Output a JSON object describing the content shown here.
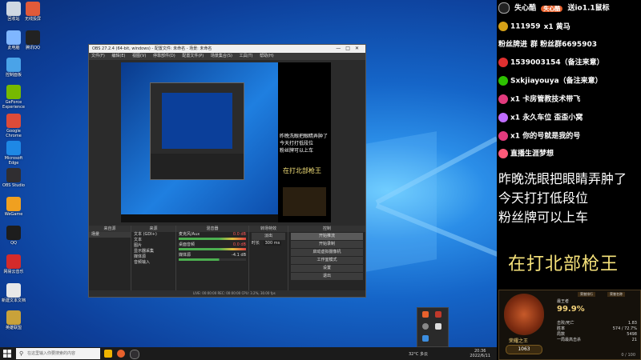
{
  "desktop": {
    "icons": [
      {
        "label": "回收站",
        "color": "#cfd8e3"
      },
      {
        "label": "无线投屏",
        "color": "#e05a3a"
      },
      {
        "label": "此电脑",
        "color": "#7fb6ff"
      },
      {
        "label": "腾讯QQ",
        "color": "#222222"
      },
      {
        "label": "控制面板",
        "color": "#4aa3e8"
      },
      {
        "label": "GeForce Experience",
        "color": "#76b900"
      },
      {
        "label": "Google Chrome",
        "color": "#dd4b39"
      },
      {
        "label": "Microsoft Edge",
        "color": "#1e88e5"
      },
      {
        "label": "OBS Studio",
        "color": "#302e31"
      },
      {
        "label": "WeGame",
        "color": "#f0a020"
      },
      {
        "label": "QQ",
        "color": "#1d1d1d"
      },
      {
        "label": "网易云音乐",
        "color": "#d42b2b"
      },
      {
        "label": "新建文本文档",
        "color": "#e8e8e8"
      },
      {
        "label": "英雄联盟",
        "color": "#c9a23a"
      }
    ]
  },
  "obs": {
    "title": "OBS 27.2.4 (64-bit, windows) - 配置文件: 未命名 - 场景: 未命名",
    "menu": [
      "文件(F)",
      "编辑(E)",
      "视图(V)",
      "停靠部件(D)",
      "配置文件(P)",
      "场景集合(S)",
      "工具(T)",
      "帮助(H)"
    ],
    "panels": {
      "scenes": {
        "header": "来自源",
        "items": [
          "场景"
        ]
      },
      "sources": {
        "header": "来源",
        "items": [
          "文本 (GDI+)",
          "文本",
          "图片",
          "显示器采集",
          "媒体源",
          "音频输入"
        ]
      },
      "mixer": {
        "header": "混音器",
        "items": [
          "麦克风/Aux",
          "桌面音频",
          "媒体源"
        ],
        "levels": [
          "0.0 dB",
          "0.0 dB",
          "-4.1 dB"
        ]
      },
      "transitions": {
        "header": "转场特效",
        "fade": "淡出",
        "duration_label": "时长",
        "duration": "300 ms"
      },
      "controls": {
        "header": "控制",
        "buttons": [
          "开始推流",
          "开始录制",
          "启动虚拟摄像机",
          "工作室模式",
          "设置",
          "退出"
        ]
      }
    },
    "status": "LIVE: 00:00:00   REC: 00:00:00   CPU: 3.2%, 30.00 fps"
  },
  "taskbar": {
    "search_placeholder": "在这里输入你要搜索的内容",
    "weather": "32°C 多云",
    "time": "20:36",
    "date": "2022/6/11"
  },
  "overlay": {
    "header_name": "失心酷",
    "header_badge": "失心酷",
    "header_text": "送io1.1鼠标",
    "rows": [
      {
        "icon": "gold-bar-icon",
        "color": "#d4a017",
        "text": "111959",
        "extra": "x1 黄马"
      },
      {
        "text": "粉丝牌进",
        "extra": "群  粉丝群6695903"
      },
      {
        "icon": "qq-icon",
        "color": "#e03030",
        "text": "1539003154（备注来意）"
      },
      {
        "icon": "wechat-icon",
        "color": "#2dc100",
        "text": "Sxkjiayouya（备注来意）"
      },
      {
        "icon": "rocket-icon",
        "color": "#e23a7d",
        "text": "x1 卡房管教技术带飞"
      },
      {
        "icon": "gift-icon",
        "color": "#c06cff",
        "text": "x1 永久车位 歪歪小窝"
      },
      {
        "icon": "rocket-icon",
        "color": "#e23a7d",
        "text": "x1 你的号就是我的号"
      },
      {
        "icon": "badge-icon",
        "color": "#ff5a7a",
        "text": "直播生涯梦想"
      }
    ],
    "big_lines": [
      "昨晚洗眼把眼睛弄肿了",
      "今天打打低段位",
      "粉丝牌可以上车"
    ],
    "main_title": "在打北部枪王",
    "card": {
      "rank_name": "荣耀之王",
      "rank_sub": "最王者",
      "percent": "99.9%",
      "level": "1063",
      "heads": [
        "荣誉排行",
        "荣誉名称"
      ],
      "stats": [
        {
          "k": "击败/死亡",
          "v": "1.83"
        },
        {
          "k": "胜率",
          "v": "574 / 72.7%"
        },
        {
          "k": "局数",
          "v": "5498"
        },
        {
          "k": "一局最高击杀",
          "v": "21"
        }
      ],
      "bottom": "0 / 100"
    }
  }
}
